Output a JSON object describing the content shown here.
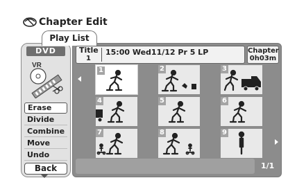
{
  "header": {
    "title": "Chapter Edit",
    "icon": "chapter-edit-icon"
  },
  "tab": {
    "label": "Play List"
  },
  "sidebar": {
    "badge": "DVD",
    "disc_label": "VR",
    "menu": [
      {
        "label": "Erase",
        "selected": true
      },
      {
        "label": "Divide",
        "selected": false
      },
      {
        "label": "Combine",
        "selected": false
      },
      {
        "label": "Move",
        "selected": false
      },
      {
        "label": "Undo",
        "selected": false
      }
    ],
    "back_label": "Back"
  },
  "info": {
    "title_label": "Title",
    "title_number": "1",
    "details": "15:00 Wed11/12  Pr 5   LP",
    "chapter_label": "Chapter",
    "chapter_time": "0h03m"
  },
  "chapters": [
    {
      "num": "1",
      "selected": true
    },
    {
      "num": "2",
      "selected": false
    },
    {
      "num": "3",
      "selected": false
    },
    {
      "num": "4",
      "selected": false
    },
    {
      "num": "5",
      "selected": false
    },
    {
      "num": "6",
      "selected": false
    },
    {
      "num": "7",
      "selected": false
    },
    {
      "num": "8",
      "selected": false
    },
    {
      "num": "9",
      "selected": false
    }
  ],
  "page": {
    "indicator": "1/1"
  }
}
